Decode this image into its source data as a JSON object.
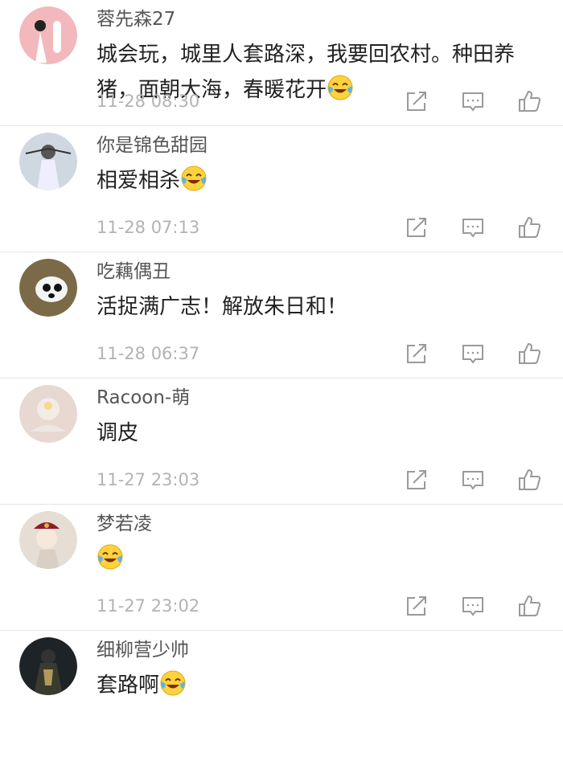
{
  "comments": [
    {
      "username": "蓉先森27",
      "text": "城会玩，城里人套路深，我要回农村。种田养猪，面朝大海，春暖花开",
      "emoji": "laugh-cry-emoji",
      "time": "11-28 08:30",
      "avatar_color": "#f2b8bc"
    },
    {
      "username": "你是锦色甜园",
      "text": "相爱相杀",
      "emoji": "laugh-cry-emoji",
      "time": "11-28 07:13",
      "avatar_color": "#cfd8e0"
    },
    {
      "username": "吃藕偶丑",
      "text": "活捉满广志！解放朱日和！",
      "emoji": "",
      "time": "11-28 06:37",
      "avatar_color": "#7a6a48"
    },
    {
      "username": "Racoon-萌",
      "text": "调皮",
      "emoji": "",
      "time": "11-27 23:03",
      "avatar_color": "#e8d8d2"
    },
    {
      "username": "梦若凌",
      "text": "",
      "emoji": "laugh-cry-emoji",
      "time": "11-27 23:02",
      "avatar_color": "#e6ddd4"
    },
    {
      "username": "细柳营少帅",
      "text": "套路啊",
      "emoji": "laugh-cry-emoji",
      "time": "",
      "avatar_color": "#1e2328"
    }
  ],
  "icons": {
    "share": "share-icon",
    "reply": "comment-icon",
    "like": "thumbs-up-icon"
  },
  "colors": {
    "time": "#b3b3b3",
    "username": "#555555",
    "divider": "#e6e6e6"
  }
}
